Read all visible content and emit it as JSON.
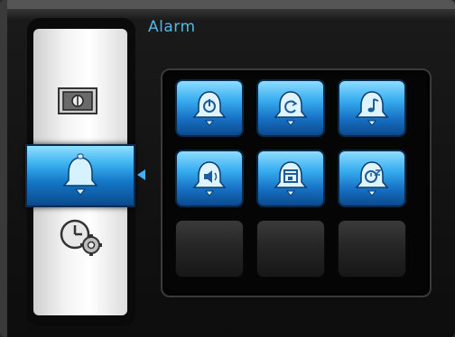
{
  "header": {
    "title": "Alarm"
  },
  "sidebar": {
    "items": [
      {
        "icon": "display-icon",
        "selected": false
      },
      {
        "icon": "alarm-bell-icon",
        "selected": true
      },
      {
        "icon": "clock-settings-icon",
        "selected": false
      }
    ]
  },
  "grid": {
    "tiles": [
      {
        "icon": "alarm-power-icon",
        "state": "active"
      },
      {
        "icon": "alarm-repeat-icon",
        "state": "active"
      },
      {
        "icon": "alarm-music-icon",
        "state": "active"
      },
      {
        "icon": "alarm-volume-icon",
        "state": "active"
      },
      {
        "icon": "alarm-calendar-icon",
        "state": "active"
      },
      {
        "icon": "alarm-snooze-icon",
        "state": "active"
      },
      {
        "icon": "",
        "state": "empty"
      },
      {
        "icon": "",
        "state": "empty"
      },
      {
        "icon": "",
        "state": "empty"
      }
    ]
  },
  "colors": {
    "accent": "#3cb2ef",
    "title": "#52b7e8",
    "background": "#121212"
  }
}
